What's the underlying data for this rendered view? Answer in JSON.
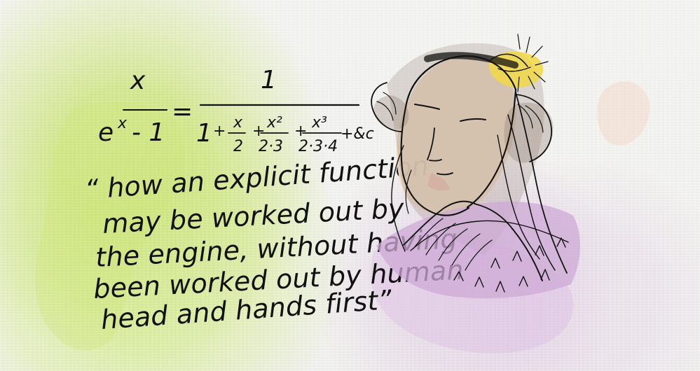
{
  "formula": {
    "lhs_numerator": "x",
    "lhs_denominator": "e",
    "lhs_exponent": "x",
    "lhs_minus_one": "- 1",
    "equals": "=",
    "rhs_numerator": "1",
    "rhs_term_1": "1",
    "rhs_plus_1": "+",
    "rhs_frac1_num": "x",
    "rhs_frac1_den": "2",
    "rhs_plus_2": "+",
    "rhs_frac2_num": "x²",
    "rhs_frac2_den": "2·3",
    "rhs_plus_3": "+",
    "rhs_frac3_num": "x³",
    "rhs_frac3_den": "2·3·4",
    "rhs_tail": "+&c"
  },
  "quote_lines": [
    "“ how an explicit function",
    "may be worked out by",
    "the engine, without having",
    "been worked out by human",
    "head and hands first”"
  ],
  "colors": {
    "ink": "#111111",
    "headband": "#f0d84a",
    "skin": "#ead8c2",
    "dress": "#cda9d6",
    "hair": "#8b7566"
  }
}
